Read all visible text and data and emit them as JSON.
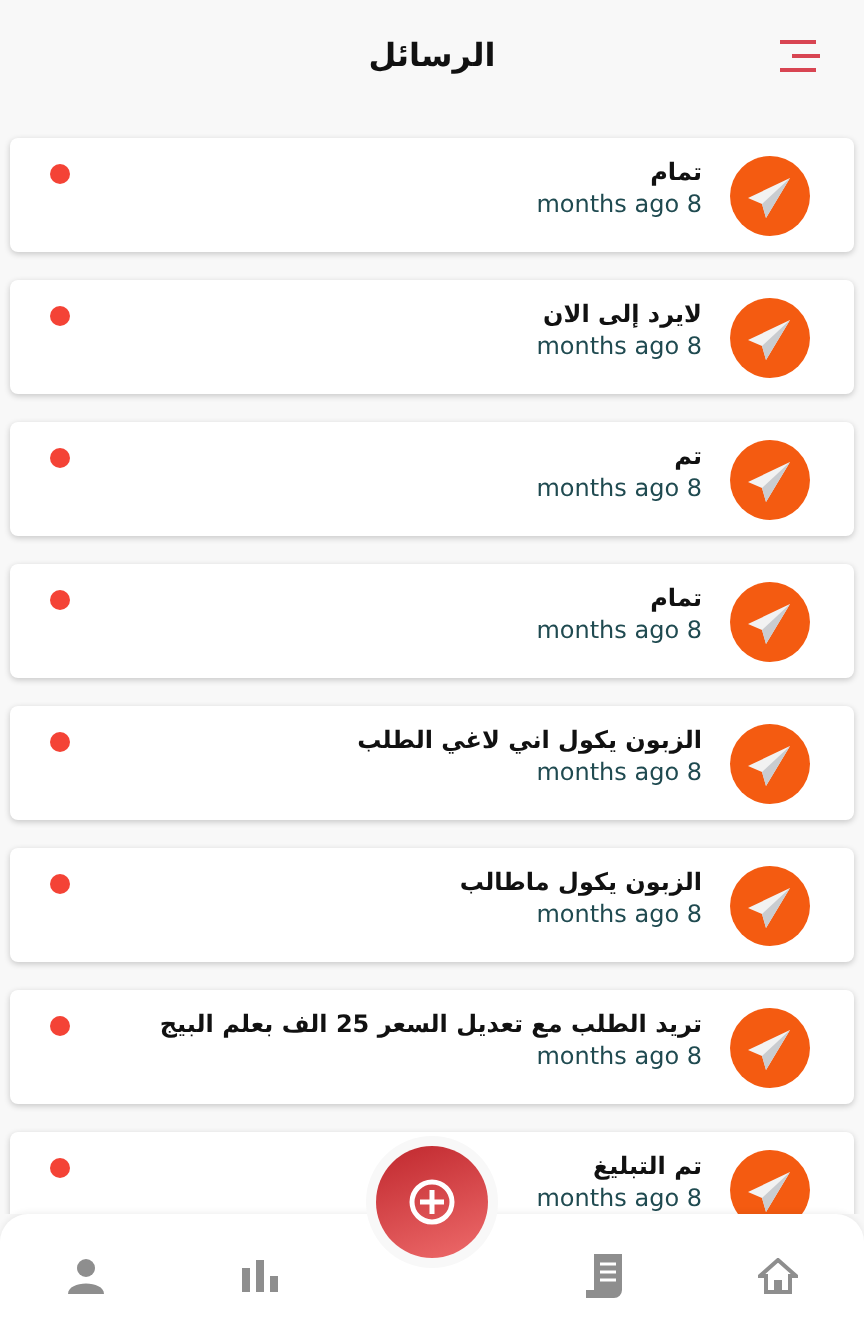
{
  "header": {
    "title": "الرسائل"
  },
  "messages": [
    {
      "title": "تمام",
      "time": "months ago 8",
      "unread": true
    },
    {
      "title": "لايرد إلى الان",
      "time": "months ago 8",
      "unread": true
    },
    {
      "title": "تم",
      "time": "months ago 8",
      "unread": true
    },
    {
      "title": "تمام",
      "time": "months ago 8",
      "unread": true
    },
    {
      "title": "الزبون يكول اني لاغي الطلب",
      "time": "months ago 8",
      "unread": true
    },
    {
      "title": "الزبون يكول ماطالب",
      "time": "months ago 8",
      "unread": true
    },
    {
      "title": "تريد الطلب مع تعديل السعر 25 الف بعلم البيج",
      "time": "months ago 8",
      "unread": true
    },
    {
      "title": "تم التبليغ",
      "time": "months ago 8",
      "unread": true
    }
  ],
  "bottom_nav": [
    {
      "kind": "profile"
    },
    {
      "kind": "stats"
    },
    {
      "kind": "add"
    },
    {
      "kind": "orders"
    },
    {
      "kind": "home"
    }
  ]
}
